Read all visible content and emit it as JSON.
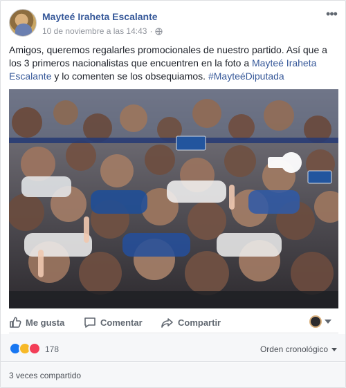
{
  "post": {
    "author": "Mayteé Iraheta Escalante",
    "timestamp": "10 de noviembre a las 14:43",
    "separator": "·",
    "privacy_icon": "globe-icon",
    "text_part1": "Amigos, queremos regalarles promocionales de nuestro partido. Así que a los 3 primeros nacionalistas que encuentren en la foto a ",
    "mention": "Mayteé Iraheta Escalante",
    "text_part2": " y lo comenten se los obsequiamos. ",
    "hashtag": "#MayteéDiputada",
    "photo_alt": "Crowd photo"
  },
  "actions": {
    "like_label": "Me gusta",
    "comment_label": "Comentar",
    "share_label": "Compartir"
  },
  "reactions": {
    "icons": [
      "like-icon",
      "haha-icon",
      "love-icon"
    ],
    "count": "178",
    "order_label": "Orden cronológico"
  },
  "shares": {
    "label": "3 veces compartido"
  },
  "colors": {
    "link": "#365899",
    "meta": "#90949c",
    "like": "#1877f2",
    "haha": "#f7b928",
    "love": "#f33e58"
  }
}
